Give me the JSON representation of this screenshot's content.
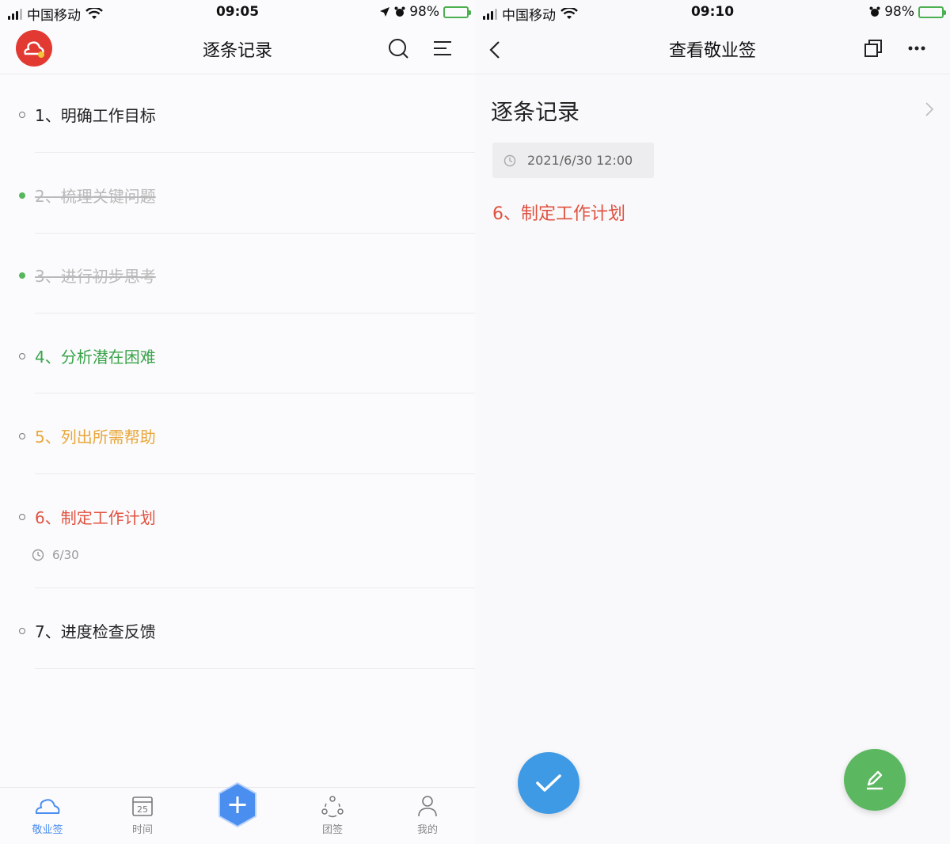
{
  "colors": {
    "accent": "#4a8ef0",
    "done": "#56b85c",
    "green_task": "#3aa34a",
    "orange_task": "#e8a73a",
    "red_task": "#e0513f",
    "logo": "#e23a33"
  },
  "left": {
    "status": {
      "carrier": "中国移动",
      "time": "09:05",
      "battery": "98%"
    },
    "nav": {
      "title": "逐条记录",
      "icons": [
        "search-icon",
        "menu-icon"
      ]
    },
    "tasks": [
      {
        "label": "1、明确工作目标",
        "state": "normal",
        "color": "#222222"
      },
      {
        "label": "2、梳理关键问题",
        "state": "done",
        "color": "#b9b9b9"
      },
      {
        "label": "3、进行初步思考",
        "state": "done",
        "color": "#b9b9b9"
      },
      {
        "label": "4、分析潜在困难",
        "state": "normal",
        "color": "#3aa34a"
      },
      {
        "label": "5、列出所需帮助",
        "state": "normal",
        "color": "#e8a73a"
      },
      {
        "label": "6、制定工作计划",
        "state": "normal",
        "color": "#e0513f",
        "due": "6/30"
      },
      {
        "label": "7、进度检查反馈",
        "state": "normal",
        "color": "#222222"
      }
    ],
    "tabs": [
      {
        "label": "敬业签",
        "icon": "cloud-icon"
      },
      {
        "label": "时间",
        "icon": "calendar-icon",
        "day": "25"
      },
      {
        "label": "团签",
        "icon": "team-icon"
      },
      {
        "label": "我的",
        "icon": "user-icon"
      }
    ]
  },
  "right": {
    "status": {
      "carrier": "中国移动",
      "time": "09:10",
      "battery": "98%"
    },
    "nav": {
      "title": "查看敬业签",
      "icons": [
        "back-icon",
        "copy-icon",
        "more-icon"
      ]
    },
    "section_title": "逐条记录",
    "date": "2021/6/30 12:00",
    "task": "6、制定工作计划"
  }
}
